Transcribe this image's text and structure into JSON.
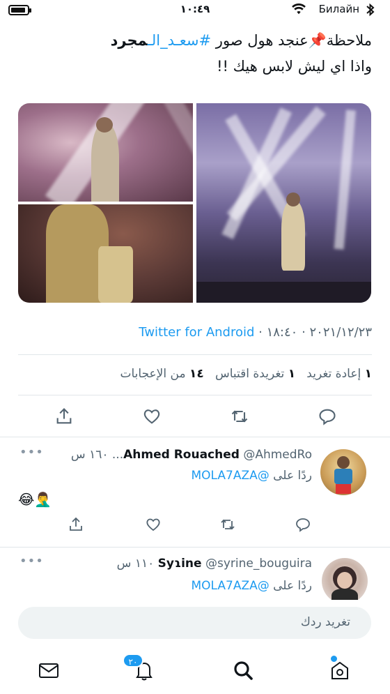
{
  "status_bar": {
    "time": "١٠:٤٩",
    "carrier": "Билайн"
  },
  "tweet": {
    "line1_prefix": "ملاحظة📌عنجد هول صور ",
    "hashtag_part1": "#سعـ",
    "hashtag_part2": "د_الـ",
    "hashtag_part3": "مجرد",
    "line2": "واذا اي ليش لابس هيك !!",
    "source": "Twitter for Android",
    "time": "١٨:٤٠",
    "date": "٢٠٢١/١٢/٢٣",
    "sep": " · "
  },
  "stats": {
    "retweets_count": "١",
    "retweets_label": "إعادة تغريد",
    "quotes_count": "١",
    "quotes_label": "تغريدة اقتباس",
    "likes_count": "١٤",
    "likes_label": "من الإعجابات"
  },
  "replies": [
    {
      "name": "Ahmed Rouached",
      "handle": "@AhmedRo...",
      "age": "١٦٠ س",
      "replying_label": "ردًا على",
      "replying_to": "@MOLA7AZA",
      "body": "😂🤦‍♂️"
    },
    {
      "name": "Syɿine",
      "handle": "@syrine_bouguira",
      "age": "١١٠ س",
      "replying_label": "ردًا على",
      "replying_to": "@MOLA7AZA"
    }
  ],
  "compose": {
    "placeholder": "تغريد ردك"
  },
  "tabbar": {
    "notifications_badge": "٢٠"
  },
  "colors": {
    "accent": "#1d9bf0",
    "text": "#0f1419",
    "muted": "#536471"
  }
}
